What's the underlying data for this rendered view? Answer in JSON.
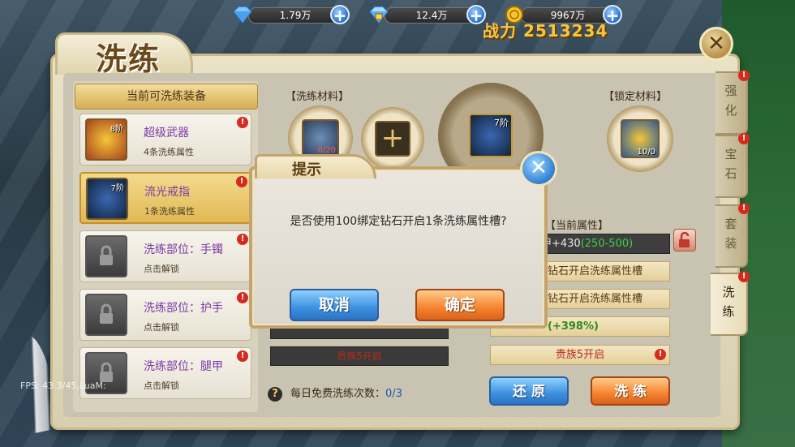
{
  "currency": [
    {
      "icon": "diamond-icon",
      "value": "1.79万"
    },
    {
      "icon": "bound-diamond-icon",
      "value": "12.4万"
    },
    {
      "icon": "gold-coin-icon",
      "value": "9967万"
    }
  ],
  "gold_banner": "战力 2513234",
  "panel": {
    "title": "洗练",
    "list_header": "当前可洗练装备",
    "items": [
      {
        "name": "超级武器",
        "sub": "4条洗练属性",
        "level": "8阶",
        "locked": false
      },
      {
        "name": "流光戒指",
        "sub": "1条洗练属性",
        "level": "7阶",
        "locked": false,
        "selected": true
      },
      {
        "name": "洗练部位：手镯",
        "sub": "点击解锁",
        "locked": true
      },
      {
        "name": "洗练部位：护手",
        "sub": "点击解锁",
        "locked": true
      },
      {
        "name": "洗练部位：腿甲",
        "sub": "点击解锁",
        "locked": true
      }
    ],
    "material_label": "【洗练材料】",
    "material_count": "0/20",
    "lock_material_label": "【锁定材料】",
    "lock_material_count": "10/0",
    "center_level": "7阶",
    "current_attr_label": "【当前属性】",
    "attr_first": "甲+430",
    "attr_first_range": "(250-500)",
    "attr_rows": [
      "钻石开启洗练属性槽",
      "钻石开启洗练属性槽",
      "(+398%)"
    ],
    "noble_left": "贵族5开启",
    "noble_right": "贵族5开启",
    "restore_label": "还 原",
    "refine_label": "洗 练",
    "daily_label": "每日免费洗练次数：",
    "daily_count": "0/3",
    "help_glyph": "?"
  },
  "side_tabs": [
    "强化",
    "宝石",
    "套装",
    "洗练"
  ],
  "dialog": {
    "title": "提示",
    "message": "是否使用100绑定钻石开启1条洗练属性槽?",
    "cancel_label": "取消",
    "confirm_label": "确定"
  },
  "fps_text": "FPS: 43.3/45,LuaM:",
  "colors": {
    "cancel": "#3d8fe0",
    "confirm": "#f5832f",
    "accent_purple": "#7a38a8",
    "alert_red": "#d42b1e"
  }
}
